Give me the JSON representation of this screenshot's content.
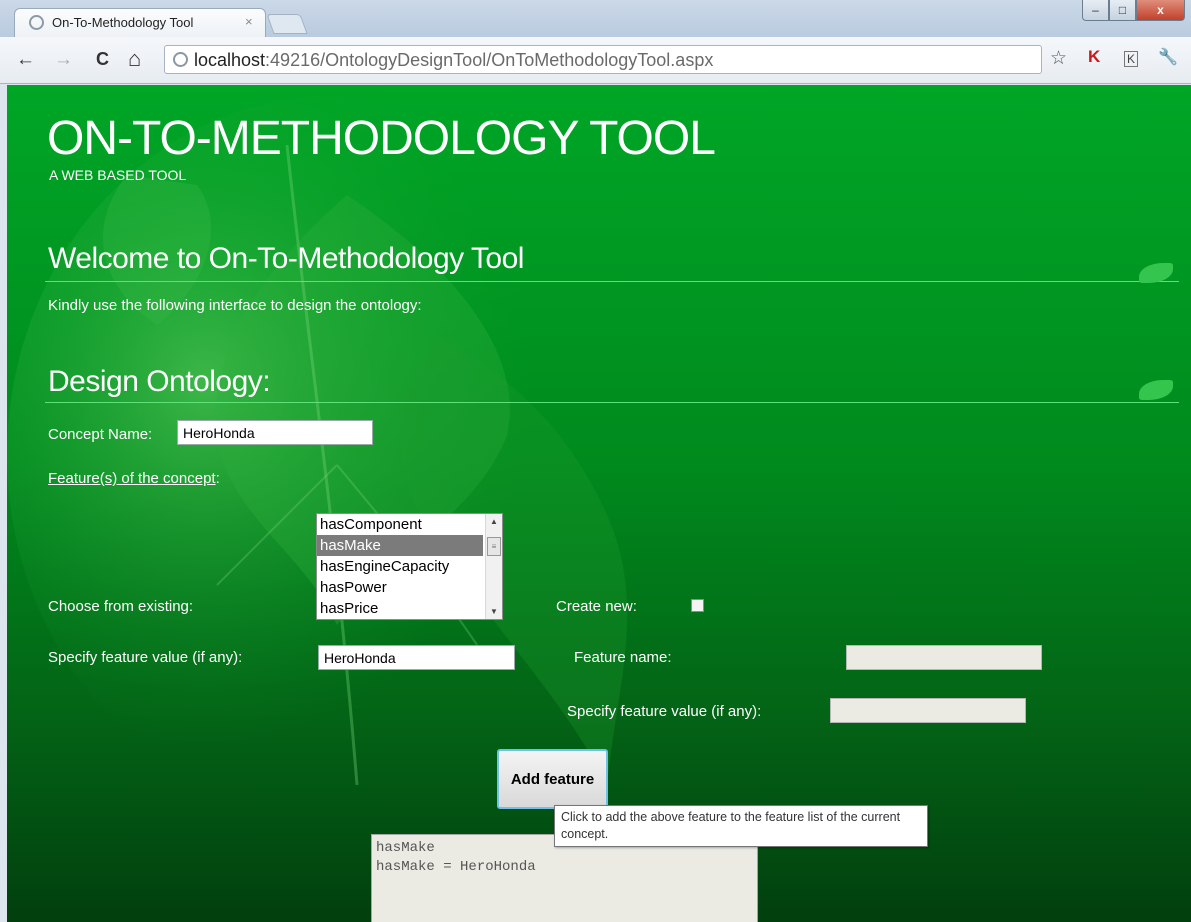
{
  "browser": {
    "tab_title": "On-To-Methodology Tool",
    "tab_close": "×",
    "url_host": "localhost",
    "url_path": ":49216/OntologyDesignTool/OnToMethodologyTool.aspx",
    "back_glyph": "←",
    "forward_glyph": "→",
    "reload_glyph": "C",
    "home_glyph": "⌂",
    "star_glyph": "☆",
    "wrench_glyph": "🔧",
    "ext1_glyph": "K",
    "ext2_glyph": "K",
    "min_glyph": "–",
    "max_glyph": "□",
    "close_glyph": "x"
  },
  "site": {
    "title": "ON-TO-METHODOLOGY TOOL",
    "subtitle": "A WEB BASED TOOL"
  },
  "welcome": {
    "heading": "Welcome to On-To-Methodology Tool",
    "intro": "Kindly use the following interface to design the ontology:"
  },
  "design": {
    "heading": "Design Ontology:",
    "concept_label": "Concept Name:",
    "concept_value": "HeroHonda",
    "features_link": "Feature(s) of the concept",
    "features_colon": ":",
    "choose_label": "Choose from existing:",
    "feature_options": [
      {
        "label": "hasComponent",
        "selected": false
      },
      {
        "label": "hasMake",
        "selected": true
      },
      {
        "label": "hasEngineCapacity",
        "selected": false
      },
      {
        "label": "hasPower",
        "selected": false
      },
      {
        "label": "hasPrice",
        "selected": false
      }
    ],
    "create_new_label": "Create new:",
    "create_new_checked": false,
    "spec_value_label": "Specify feature value (if any):",
    "spec_value": "HeroHonda",
    "feature_name_label": "Feature name:",
    "feature_name_value": "",
    "spec_value_label2": "Specify feature value (if any):",
    "spec_value2": "",
    "add_button": "Add feature",
    "tooltip": "Click to add the above feature to the feature list of the current concept.",
    "feature_list_text": "hasMake\nhasMake = HeroHonda"
  },
  "colors": {
    "page_green": "#00a626",
    "rule_green": "#5ee07a",
    "button_focus": "#6fc1e8"
  }
}
